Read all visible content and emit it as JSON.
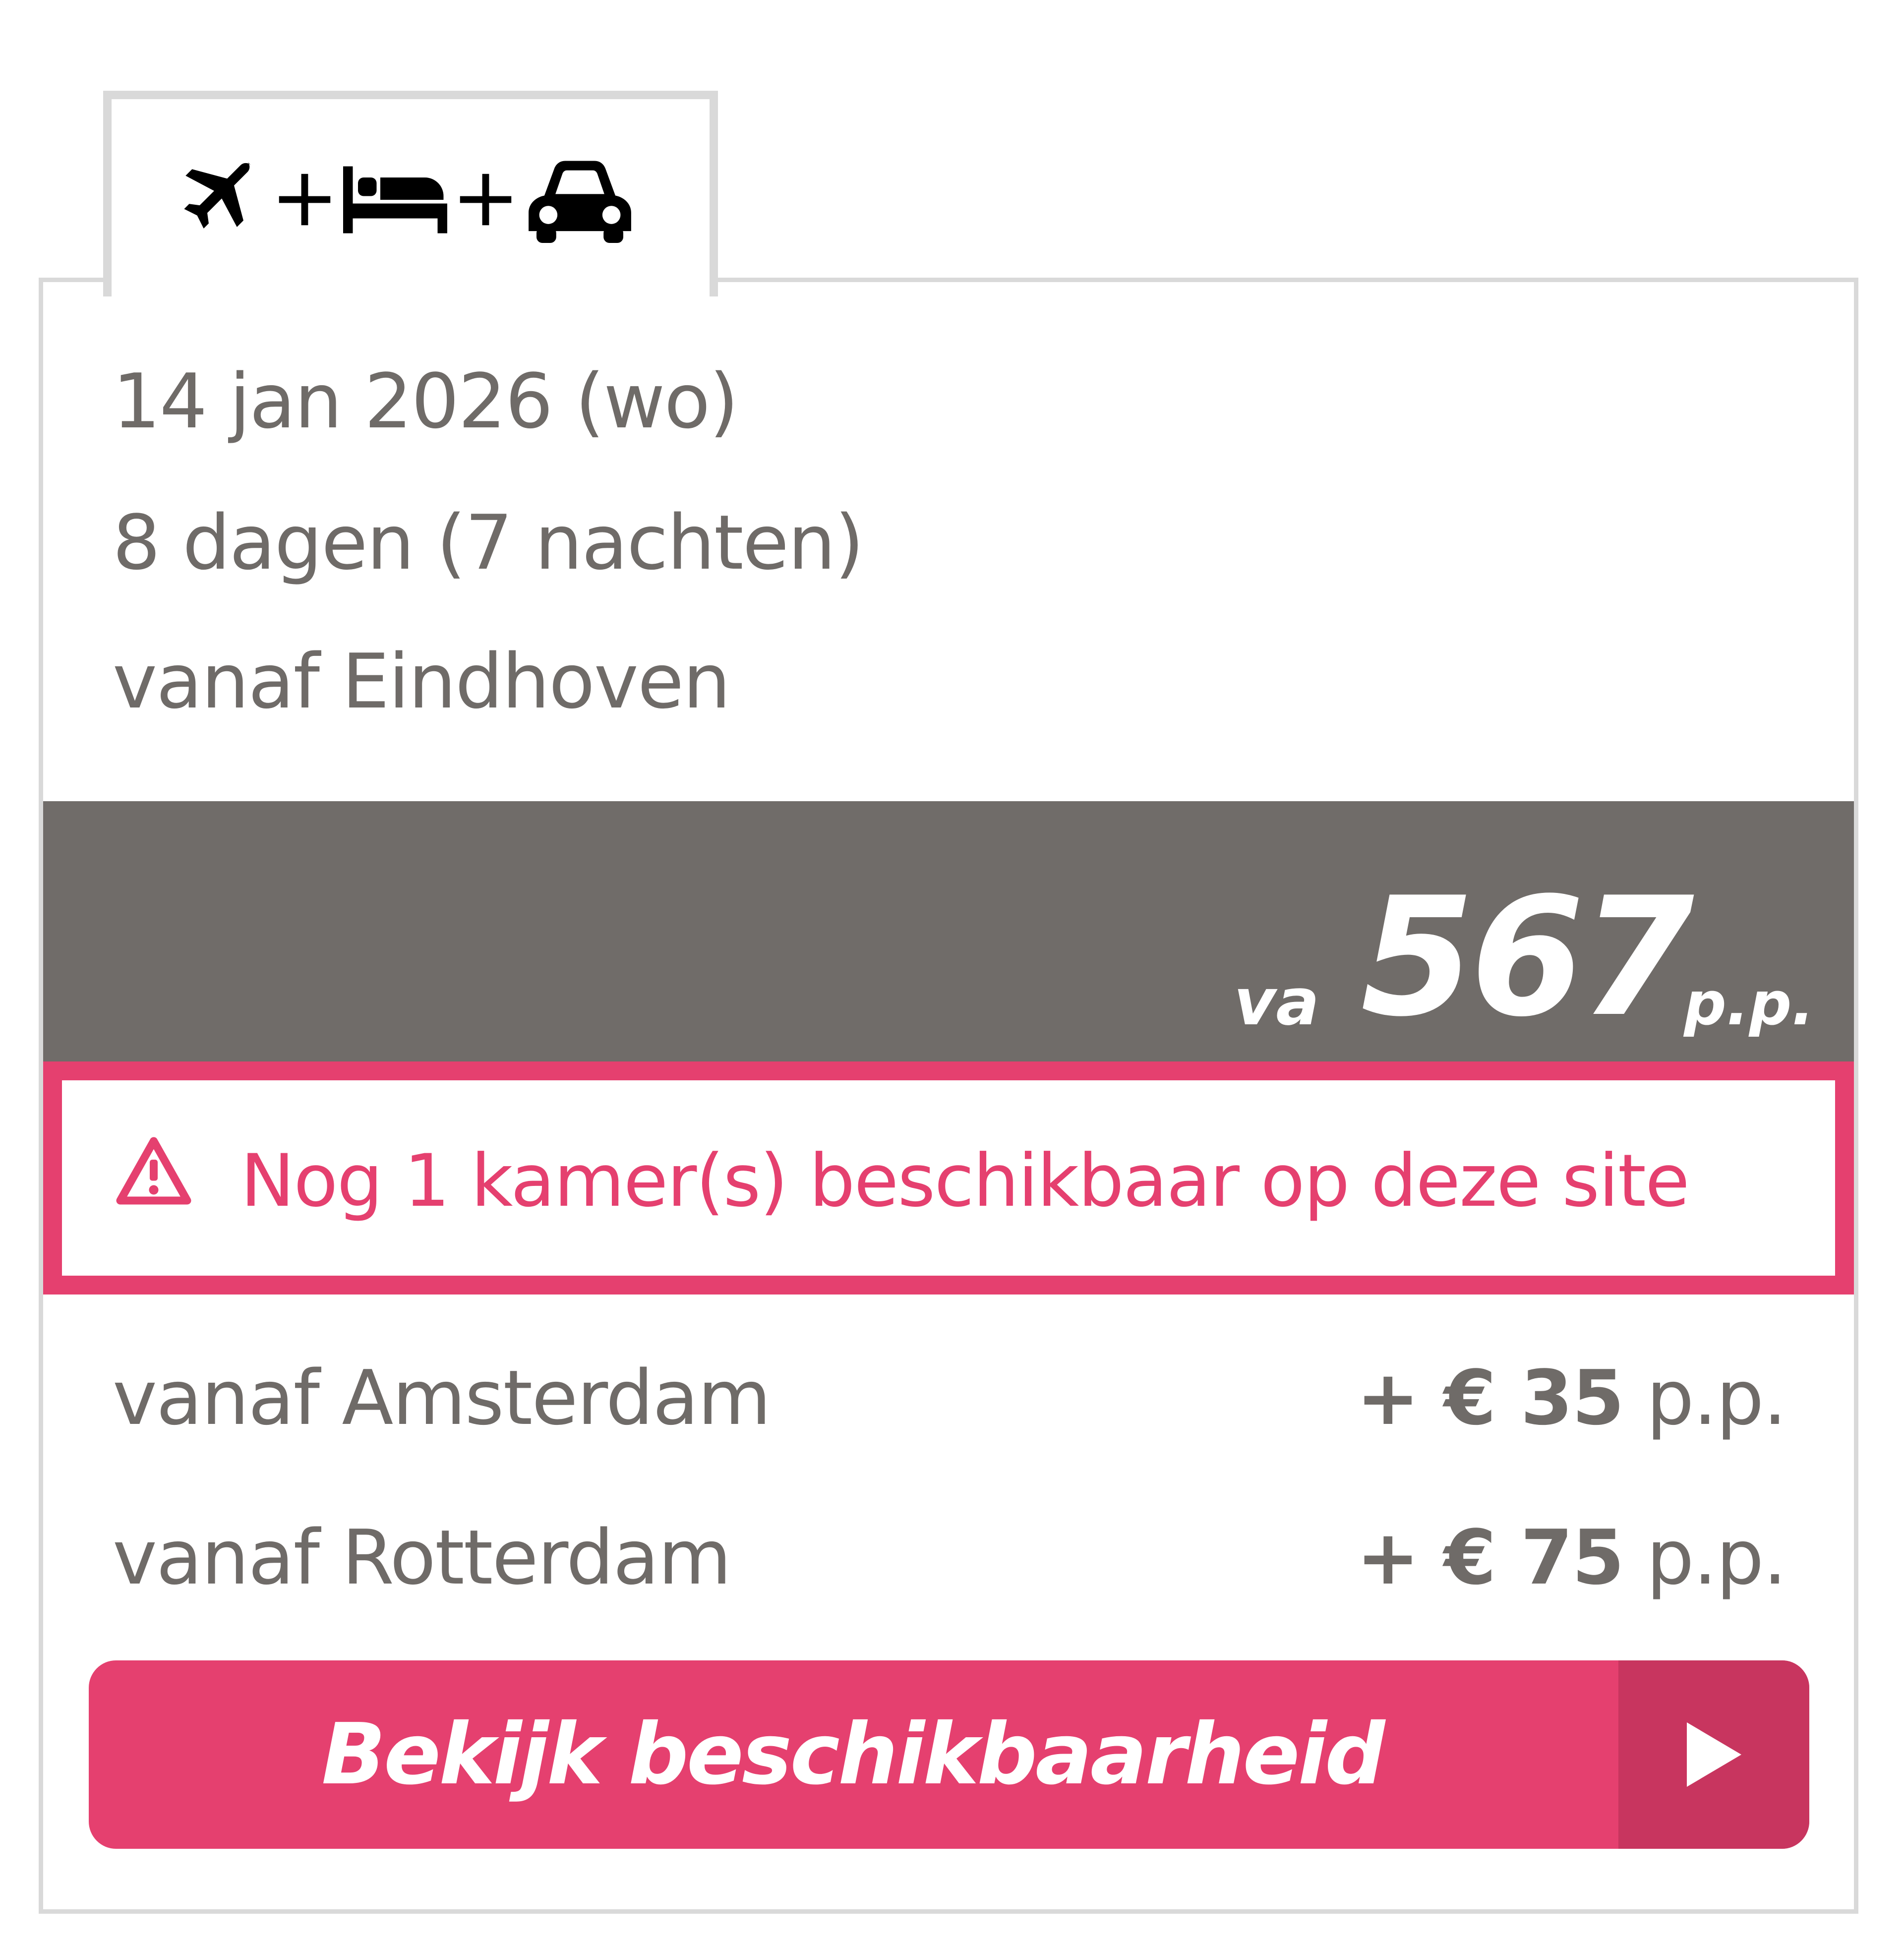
{
  "tab": {
    "icons": [
      "plane-icon",
      "plus-icon",
      "bed-icon",
      "plus-icon",
      "car-icon"
    ]
  },
  "trip": {
    "date": "14 jan 2026 (wo)",
    "duration": "8 dagen (7 nachten)",
    "departure": "vanaf Eindhoven"
  },
  "price": {
    "prefix": "va",
    "value": "567",
    "suffix": "p.p."
  },
  "alert": {
    "icon": "warning-icon",
    "text": "Nog 1 kamer(s) beschikbaar op deze site"
  },
  "alternatives": [
    {
      "label": "vanaf Amsterdam",
      "amount": "+ € 35",
      "unit": "p.p."
    },
    {
      "label": "vanaf Rotterdam",
      "amount": "+ € 75",
      "unit": "p.p."
    }
  ],
  "cta": {
    "label": "Bekijk beschikbaarheid",
    "icon": "play-arrow-icon"
  },
  "colors": {
    "accent": "#e5406f",
    "accent_dark": "#c8355f",
    "price_band": "#706c69",
    "text": "#6f6b68",
    "border": "#d9d9d9"
  }
}
